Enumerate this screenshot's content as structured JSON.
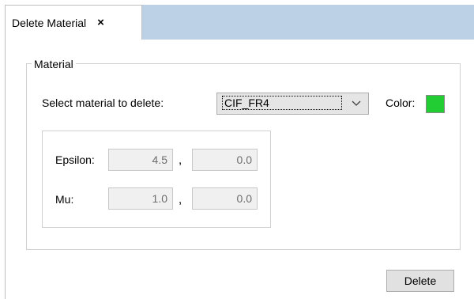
{
  "tab": {
    "title": "Delete Material",
    "close_glyph": "×"
  },
  "material_group": {
    "title": "Material",
    "select_label": "Select material to delete:",
    "selected_material": "CIF_FR4",
    "color_label": "Color:",
    "color_value": "#22cc33"
  },
  "properties": {
    "epsilon": {
      "label": "Epsilon:",
      "real": "4.5",
      "separator": ",",
      "imag": "0.0"
    },
    "mu": {
      "label": "Mu:",
      "real": "1.0",
      "separator": ",",
      "imag": "0.0"
    }
  },
  "actions": {
    "delete_label": "Delete"
  },
  "icons": {
    "tab_close": "close-icon",
    "combo_arrow": "chevron-down-icon"
  }
}
